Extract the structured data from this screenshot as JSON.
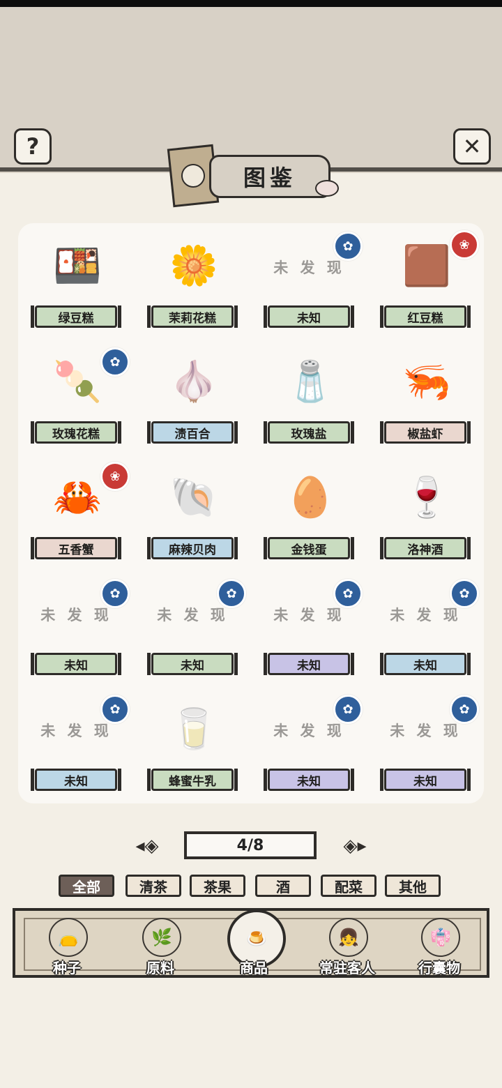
{
  "header": {
    "title": "图鉴",
    "help_icon": "question-mark-icon",
    "close_icon": "close-x-icon"
  },
  "catalog": [
    {
      "name": "绿豆糕",
      "discovered": true,
      "plate_color": "#c9dcc0",
      "badge": null,
      "icon": "🍱"
    },
    {
      "name": "茉莉花糕",
      "discovered": true,
      "plate_color": "#c9dcc0",
      "badge": null,
      "icon": "🌼"
    },
    {
      "name": "未知",
      "discovered": false,
      "plate_color": "#c9dcc0",
      "badge": "blue",
      "icon": ""
    },
    {
      "name": "红豆糕",
      "discovered": true,
      "plate_color": "#c9dcc0",
      "badge": "red",
      "icon": "🟫"
    },
    {
      "name": "玫瑰花糕",
      "discovered": true,
      "plate_color": "#c9dcc0",
      "badge": "blue",
      "icon": "🍡"
    },
    {
      "name": "渍百合",
      "discovered": true,
      "plate_color": "#bcd7e6",
      "badge": null,
      "icon": "🧄"
    },
    {
      "name": "玫瑰盐",
      "discovered": true,
      "plate_color": "#c9dcc0",
      "badge": null,
      "icon": "🧂"
    },
    {
      "name": "椒盐虾",
      "discovered": true,
      "plate_color": "#ead7cf",
      "badge": null,
      "icon": "🦐"
    },
    {
      "name": "五香蟹",
      "discovered": true,
      "plate_color": "#ead7cf",
      "badge": "red",
      "icon": "🦀"
    },
    {
      "name": "麻辣贝肉",
      "discovered": true,
      "plate_color": "#bcd7e6",
      "badge": null,
      "icon": "🐚"
    },
    {
      "name": "金钱蛋",
      "discovered": true,
      "plate_color": "#c9dcc0",
      "badge": null,
      "icon": "🥚"
    },
    {
      "name": "洛神酒",
      "discovered": true,
      "plate_color": "#c9dcc0",
      "badge": null,
      "icon": "🍷"
    },
    {
      "name": "未知",
      "discovered": false,
      "plate_color": "#c9dcc0",
      "badge": "blue",
      "icon": ""
    },
    {
      "name": "未知",
      "discovered": false,
      "plate_color": "#c9dcc0",
      "badge": "blue",
      "icon": ""
    },
    {
      "name": "未知",
      "discovered": false,
      "plate_color": "#c8c3e6",
      "badge": "blue",
      "icon": ""
    },
    {
      "name": "未知",
      "discovered": false,
      "plate_color": "#bcd7e6",
      "badge": "blue",
      "icon": ""
    },
    {
      "name": "未知",
      "discovered": false,
      "plate_color": "#bcd7e6",
      "badge": "blue",
      "icon": ""
    },
    {
      "name": "蜂蜜牛乳",
      "discovered": true,
      "plate_color": "#c9dcc0",
      "badge": null,
      "icon": "🥛"
    },
    {
      "name": "未知",
      "discovered": false,
      "plate_color": "#c8c3e6",
      "badge": "blue",
      "icon": ""
    },
    {
      "name": "未知",
      "discovered": false,
      "plate_color": "#c8c3e6",
      "badge": "blue",
      "icon": ""
    }
  ],
  "undiscovered_label": "未 发 现",
  "pager": {
    "label": "4/8",
    "prev_icon": "arrow-left-icon",
    "next_icon": "arrow-right-icon"
  },
  "filters": [
    {
      "label": "全部",
      "active": true
    },
    {
      "label": "清茶",
      "active": false
    },
    {
      "label": "茶果",
      "active": false
    },
    {
      "label": "酒",
      "active": false
    },
    {
      "label": "配菜",
      "active": false
    },
    {
      "label": "其他",
      "active": false
    }
  ],
  "nav": [
    {
      "label": "种子",
      "icon": "seed-bag-icon",
      "glyph": "👝",
      "selected": false
    },
    {
      "label": "原料",
      "icon": "tea-leaf-icon",
      "glyph": "🌿",
      "selected": false
    },
    {
      "label": "商品",
      "icon": "cake-plate-icon",
      "glyph": "🍮",
      "selected": true
    },
    {
      "label": "常驻客人",
      "icon": "girl-avatar-icon",
      "glyph": "👧",
      "selected": false
    },
    {
      "label": "行囊物",
      "icon": "robe-icon",
      "glyph": "👘",
      "selected": false
    }
  ]
}
